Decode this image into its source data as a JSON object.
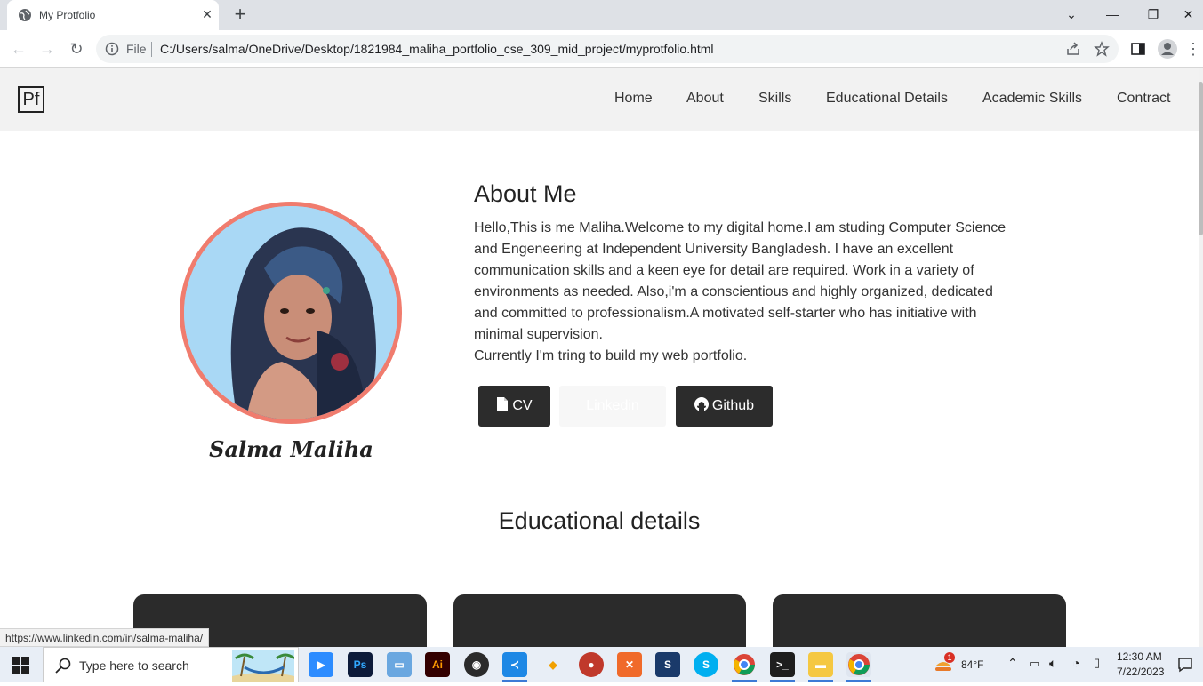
{
  "browser": {
    "tab_title": "My Protfolio",
    "file_label": "File",
    "url": "C:/Users/salma/OneDrive/Desktop/1821984_maliha_portfolio_cse_309_mid_project/myprotfolio.html"
  },
  "site": {
    "logo": "Pf",
    "nav": [
      "Home",
      "About",
      "Skills",
      "Educational Details",
      "Academic Skills",
      "Contract"
    ]
  },
  "profile": {
    "name": "Salma Maliha"
  },
  "about": {
    "title": "About Me",
    "text": "Hello,This is me Maliha.Welcome to my digital home.I am studing Computer Science and Engeneering at Independent University Bangladesh. I have an excellent communication skills and a keen eye for detail are required. Work in a variety of environments as needed. Also,i'm a conscientious and highly organized, dedicated and committed to professionalism.A motivated self-starter who has initiative with minimal supervision.",
    "text2": "Currently I'm tring to build my web portfolio.",
    "buttons": {
      "cv": "CV",
      "linkedin": "Linkedin",
      "github": "Github"
    }
  },
  "education": {
    "title": "Educational details"
  },
  "status_bar": {
    "link": "https://www.linkedin.com/in/salma-maliha/"
  },
  "taskbar": {
    "search_placeholder": "Type here to search",
    "weather": "84°F",
    "weather_badge": "1",
    "time": "12:30 AM",
    "date": "7/22/2023"
  },
  "colors": {
    "accent_ring": "#f07c6e",
    "button_dark": "#2c2c2c",
    "nav_bg": "#f2f2f2"
  }
}
